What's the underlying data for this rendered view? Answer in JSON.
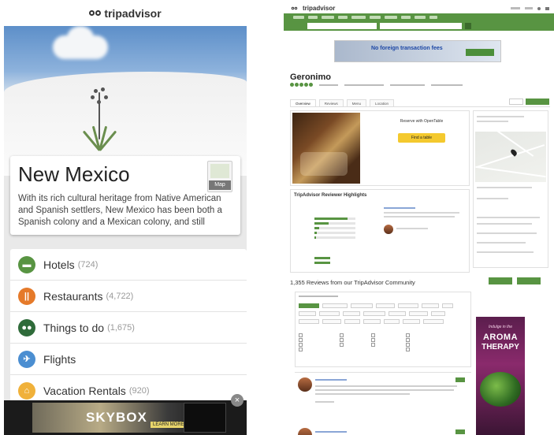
{
  "mobile": {
    "brand": "tripadvisor",
    "destination": {
      "title": "New Mexico",
      "description": "With its rich cultural heritage from Native American and Spanish settlers, New Mexico has been both a Spanish colony and a Mexican colony, and still",
      "map_label": "Map"
    },
    "categories": [
      {
        "label": "Hotels",
        "count": "(724)",
        "icon": "bed-icon",
        "color": "#589442"
      },
      {
        "label": "Restaurants",
        "count": "(4,722)",
        "icon": "fork-knife-icon",
        "color": "#e57a2a"
      },
      {
        "label": "Things to do",
        "count": "(1,675)",
        "icon": "binoculars-icon",
        "color": "#2f6b3a"
      },
      {
        "label": "Flights",
        "count": "",
        "icon": "airplane-icon",
        "color": "#4b8ed1"
      },
      {
        "label": "Vacation Rentals",
        "count": "(920)",
        "icon": "house-icon",
        "color": "#f0b13a"
      }
    ],
    "banner": {
      "text": "SKYBOX",
      "cta": "LEARN MORE",
      "close": "×"
    }
  },
  "desktop": {
    "brand": "tripadvisor",
    "ad": {
      "headline": "No foreign transaction fees"
    },
    "restaurant": {
      "name": "Geronimo"
    },
    "tabs": [
      "Overview",
      "Reviews",
      "Menu",
      "Location"
    ],
    "reservation": {
      "heading": "Reserve with OpenTable",
      "button": "Find a table"
    },
    "highlights": {
      "title": "TripAdvisor Reviewer Highlights"
    },
    "reviews": {
      "count_text": "1,355 Reviews from our TripAdvisor Community"
    },
    "aroma_ad": {
      "line1": "Indulge in the",
      "line2": "AROMA",
      "line3": "THERAPY"
    },
    "colors": {
      "brand_green": "#589442",
      "cta_yellow": "#f4c92e"
    }
  }
}
